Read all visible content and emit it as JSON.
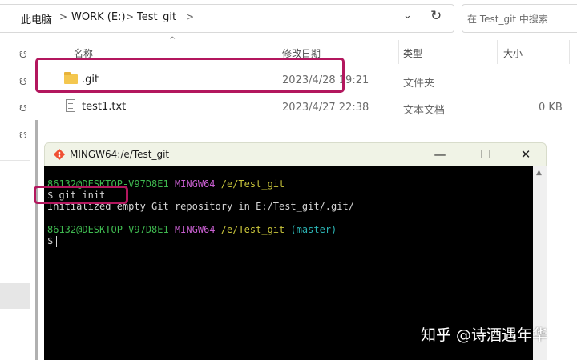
{
  "explorer": {
    "breadcrumb": [
      "此电脑",
      "WORK (E:)",
      "Test_git"
    ],
    "search_placeholder": "在 Test_git 中搜索",
    "columns": {
      "name": "名称",
      "modified": "修改日期",
      "type": "类型",
      "size": "大小"
    },
    "files": [
      {
        "name": ".git",
        "modified": "2023/4/28 19:21",
        "type": "文件夹",
        "size": "",
        "icon": "folder-icon"
      },
      {
        "name": "test1.txt",
        "modified": "2023/4/27 22:38",
        "type": "文本文档",
        "size": "0 KB",
        "icon": "text-file-icon"
      }
    ]
  },
  "terminal": {
    "title": "MINGW64:/e/Test_git",
    "lines": [
      {
        "user": "86132@DESKTOP-V97D8E1",
        "env": "MINGW64",
        "path": "/e/Test_git",
        "branch": ""
      },
      {
        "prompt": "$",
        "command": "git init"
      },
      {
        "output": "Initialized empty Git repository in E:/Test_git/.git/"
      },
      {
        "user": "86132@DESKTOP-V97D8E1",
        "env": "MINGW64",
        "path": "/e/Test_git",
        "branch": "(master)"
      },
      {
        "prompt": "$",
        "command": ""
      }
    ],
    "colors": {
      "background": "#000000",
      "user": "#3fb950",
      "env": "#c85fd0",
      "path": "#c9c53b",
      "branch": "#2bb3b3"
    }
  },
  "watermark": "知乎 @诗酒遇年华",
  "highlight_color": "#b3175e"
}
